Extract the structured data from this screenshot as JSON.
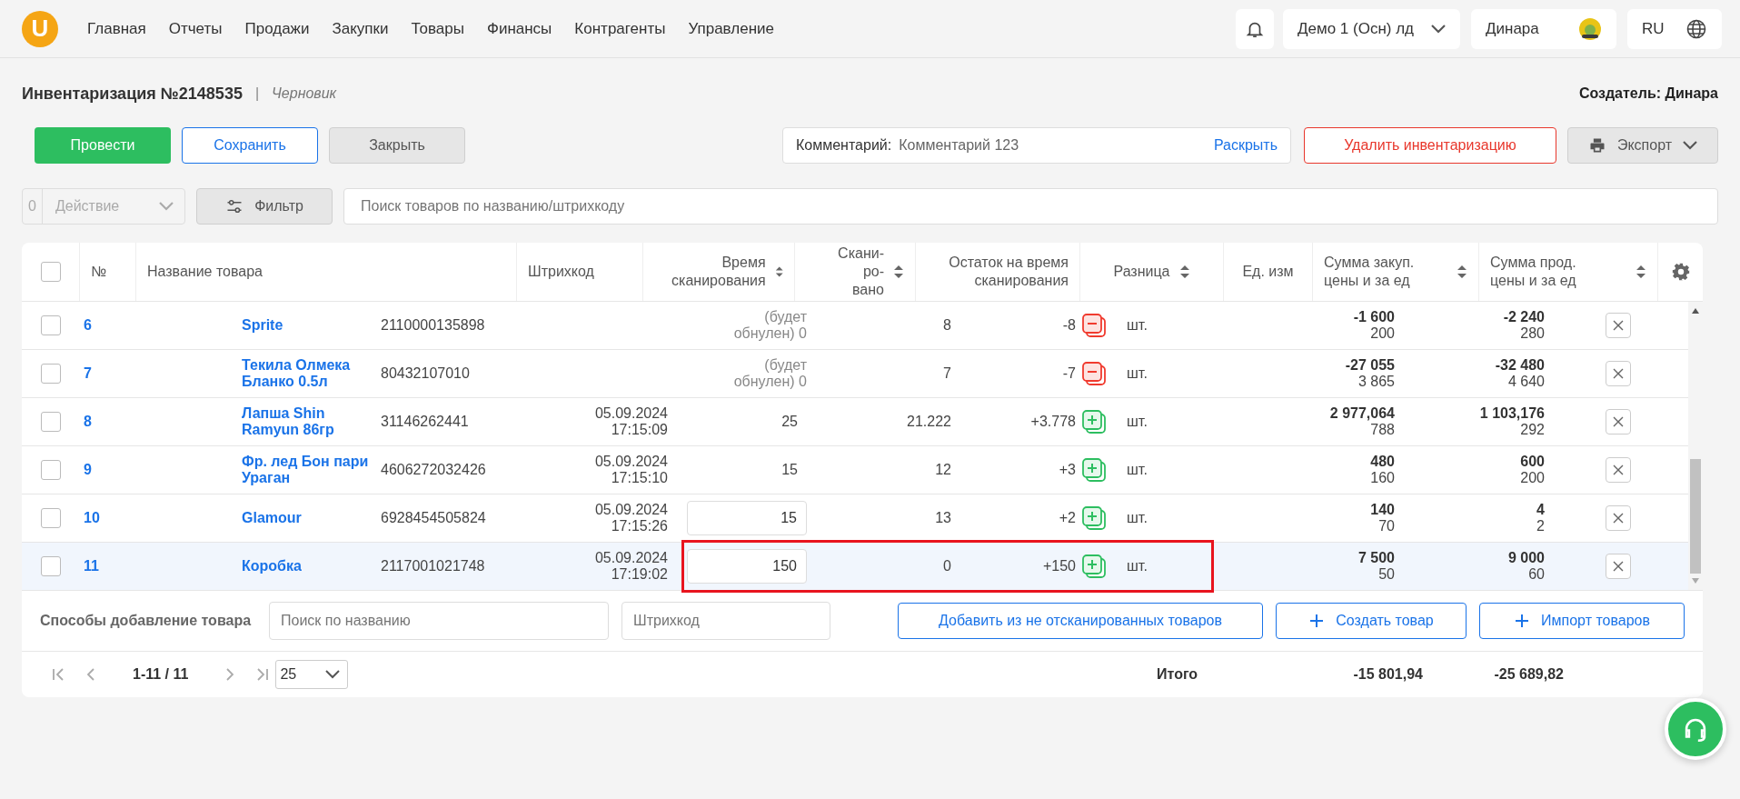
{
  "topbar": {
    "logo": "U",
    "nav": [
      "Главная",
      "Отчеты",
      "Продажи",
      "Закупки",
      "Товары",
      "Финансы",
      "Контрагенты",
      "Управление"
    ],
    "company": "Демо 1 (Осн) лд",
    "user": "Динара",
    "language": "RU"
  },
  "document": {
    "title": "Инвентаризация №2148535",
    "separator": "|",
    "status": "Черновик",
    "creator": "Создатель: Динара"
  },
  "actions": {
    "post": "Провести",
    "save": "Сохранить",
    "close": "Закрыть",
    "comment_label": "Комментарий:",
    "comment_value": "Комментарий 123",
    "comment_expand": "Раскрыть",
    "delete": "Удалить инвентаризацию",
    "export": "Экспорт"
  },
  "toolbar": {
    "selected_count": "0",
    "action": "Действие",
    "action_disabled": true,
    "filter": "Фильтр",
    "search_placeholder": "Поиск товаров по названию/штрихкоду"
  },
  "table": {
    "select_all_checked": false,
    "columns": [
      {
        "label": "№",
        "sortable": false
      },
      {
        "label": "Название товара",
        "sortable": false
      },
      {
        "label": "Штрихкод",
        "sortable": false
      },
      {
        "label": "Время сканирования",
        "sortable": true
      },
      {
        "label": "Скани-ро-вано",
        "sortable": true
      },
      {
        "label": "Остаток на время сканирования",
        "sortable": false
      },
      {
        "label": "Разница",
        "sortable": true
      },
      {
        "label": "Ед. изм",
        "sortable": false
      },
      {
        "label": "Сумма закуп. цены и за ед",
        "sortable": true
      },
      {
        "label": "Сумма прод. цены и за ед",
        "sortable": true
      }
    ],
    "rows": [
      {
        "checked": false,
        "hovered": false,
        "annotated": false,
        "number": "6",
        "name": "Sprite",
        "barcode": "2110000135898",
        "scanned": {
          "kind": "note",
          "value": "(будет обнулен) 0"
        },
        "stock": "8",
        "difference": "-8",
        "kind": "minus",
        "unit": "шт.",
        "purchase_total": "-1 600",
        "purchase_unit": "200",
        "sale_total": "-2 240",
        "sale_unit": "280"
      },
      {
        "checked": false,
        "hovered": false,
        "annotated": false,
        "number": "7",
        "name": "Текила Олмека Бланко 0.5л",
        "barcode": "80432107010",
        "scanned": {
          "kind": "note",
          "value": "(будет обнулен) 0"
        },
        "stock": "7",
        "difference": "-7",
        "kind": "minus",
        "unit": "шт.",
        "purchase_total": "-27 055",
        "purchase_unit": "3 865",
        "sale_total": "-32 480",
        "sale_unit": "4 640"
      },
      {
        "checked": false,
        "hovered": false,
        "annotated": false,
        "number": "8",
        "name": "Лапша Shin Ramyun 86гр",
        "barcode": "31146262441",
        "date": "05.09.2024",
        "time": "17:15:09",
        "scanned": {
          "kind": "text",
          "value": "25"
        },
        "stock": "21.222",
        "difference": "+3.778",
        "kind": "plus",
        "unit": "шт.",
        "purchase_total": "2 977,064",
        "purchase_unit": "788",
        "sale_total": "1 103,176",
        "sale_unit": "292"
      },
      {
        "checked": false,
        "hovered": false,
        "annotated": false,
        "number": "9",
        "name": "Фр. лед Бон пари Ураган",
        "barcode": "4606272032426",
        "date": "05.09.2024",
        "time": "17:15:10",
        "scanned": {
          "kind": "text",
          "value": "15"
        },
        "stock": "12",
        "difference": "+3",
        "kind": "plus",
        "unit": "шт.",
        "purchase_total": "480",
        "purchase_unit": "160",
        "sale_total": "600",
        "sale_unit": "200"
      },
      {
        "checked": false,
        "hovered": false,
        "annotated": false,
        "number": "10",
        "name": "Glamour",
        "barcode": "6928454505824",
        "date": "05.09.2024",
        "time": "17:15:26",
        "scanned": {
          "kind": "input",
          "value": "15"
        },
        "stock": "13",
        "difference": "+2",
        "kind": "plus",
        "unit": "шт.",
        "purchase_total": "140",
        "purchase_unit": "70",
        "sale_total": "4",
        "sale_unit": "2"
      },
      {
        "checked": false,
        "hovered": true,
        "annotated": true,
        "number": "11",
        "name": "Коробка",
        "barcode": "2117001021748",
        "date": "05.09.2024",
        "time": "17:19:02",
        "scanned": {
          "kind": "input",
          "value": "150"
        },
        "stock": "0",
        "difference": "+150",
        "kind": "plus",
        "unit": "шт.",
        "purchase_total": "7 500",
        "purchase_unit": "50",
        "sale_total": "9 000",
        "sale_unit": "60"
      }
    ]
  },
  "add_products": {
    "label": "Способы добавление товара",
    "name_placeholder": "Поиск по названию",
    "barcode_placeholder": "Штрихкод",
    "add_unscanned": "Добавить из не отсканированных товаров",
    "create": "Создать товар",
    "import": "Импорт товаров"
  },
  "pager": {
    "range": "1-11 / 11",
    "page_size": "25"
  },
  "totals": {
    "label": "Итого",
    "purchase": "-15 801,94",
    "sale": "-25 689,82"
  }
}
